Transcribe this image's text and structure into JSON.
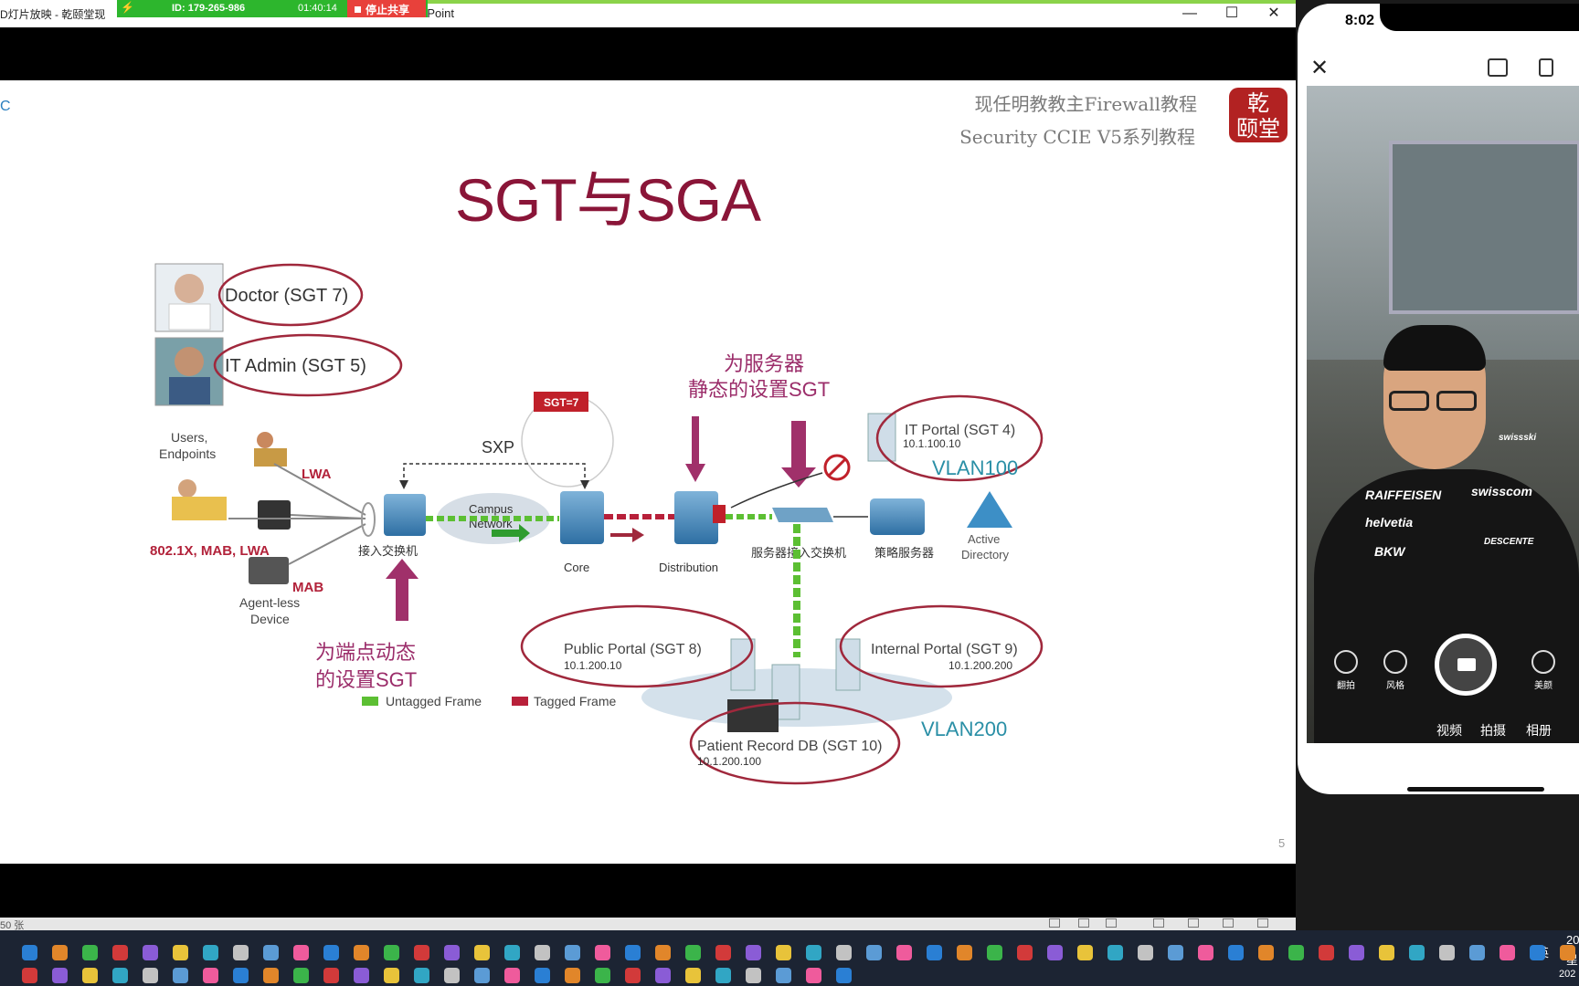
{
  "window": {
    "title_left": "D灯片放映 - 乾颐堂现",
    "title_right": "rPoint",
    "share_id": "ID: 179-265-986",
    "share_time": "01:40:14",
    "stop_share": "停止共享",
    "minimize": "—",
    "maximize": "☐",
    "close": "✕"
  },
  "slide": {
    "corner_text": "C",
    "header_line1": "现任明教教主Firewall教程",
    "header_line2": "Security CCIE V5系列教程",
    "seal_text": "乾颐堂",
    "title": "SGT与SGA",
    "page_number": "5",
    "diagram": {
      "doctor": "Doctor (SGT 7)",
      "it_admin": "IT Admin (SGT 5)",
      "users_endpoints": "Users, Endpoints",
      "lwa": "LWA",
      "auth_methods": "802.1X, MAB, LWA",
      "mab": "MAB",
      "agentless": "Agent-less Device",
      "access_switch": "接入交换机",
      "campus_network": "Campus Network",
      "core": "Core",
      "distribution": "Distribution",
      "sxp": "SXP",
      "sgt_tag": "SGT=7",
      "server_static_1": "为服务器",
      "server_static_2": "静态的设置SGT",
      "it_portal": "IT Portal (SGT 4)",
      "it_portal_ip": "10.1.100.10",
      "vlan100": "VLAN100",
      "server_access_switch": "服务器接入交换机",
      "policy_server": "策略服务器",
      "active_directory": "Active Directory",
      "endpoint_dynamic_1": "为端点动态",
      "endpoint_dynamic_2": "的设置SGT",
      "untagged_frame": "Untagged Frame",
      "tagged_frame": "Tagged Frame",
      "public_portal": "Public Portal (SGT 8)",
      "public_portal_ip": "10.1.200.10",
      "internal_portal": "Internal Portal (SGT 9)",
      "internal_portal_ip": "10.1.200.200",
      "patient_db": "Patient Record DB (SGT 10)",
      "patient_db_ip": "10.1.200.100",
      "vlan200": "VLAN200"
    }
  },
  "statusbar": {
    "left_text": "50 张"
  },
  "taskbar": {
    "ime": "英",
    "clock_line1": "20",
    "clock_line2": "星",
    "clock_year": "202"
  },
  "phone": {
    "time": "8:02",
    "controls": [
      "翻拍",
      "风格",
      "美颜"
    ],
    "jacket_texts": [
      "RAIFFEISEN",
      "helvetia",
      "BKW",
      "swisscom",
      "DESCENTE",
      "swissski"
    ],
    "modes": [
      "视频",
      "拍摄",
      "相册"
    ]
  },
  "colors": {
    "title": "#8a1538",
    "annotation": "#9b2d6a",
    "vlan": "#2a8fa6",
    "ellipse": "#a0283c",
    "share_green": "#2db62d",
    "stop_red": "#e8413b"
  }
}
